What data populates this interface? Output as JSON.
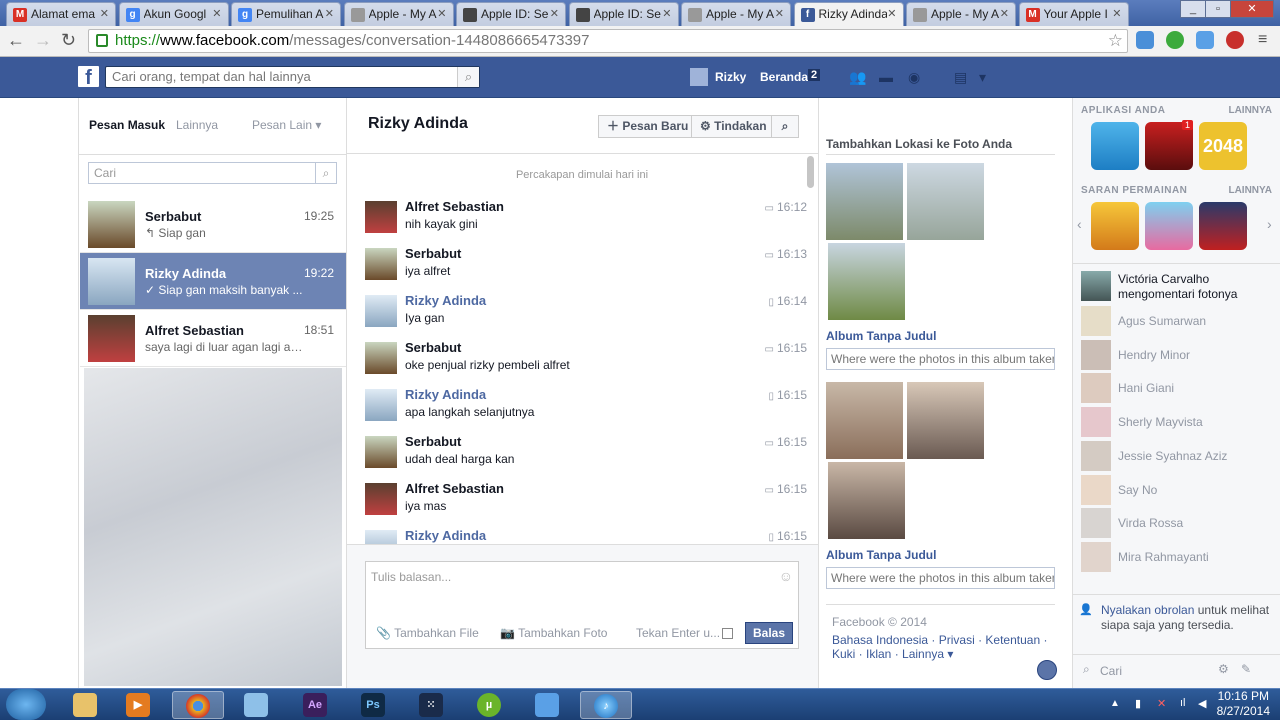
{
  "browser": {
    "tabs": [
      {
        "label": "Alamat ema",
        "fav": "M",
        "color": "#d93025"
      },
      {
        "label": "Akun Googl",
        "fav": "g",
        "color": "#4285f4"
      },
      {
        "label": "Pemulihan A",
        "fav": "g",
        "color": "#4285f4"
      },
      {
        "label": "Apple - My A",
        "fav": "",
        "color": "#999999"
      },
      {
        "label": "Apple ID: Se",
        "fav": "",
        "color": "#444444"
      },
      {
        "label": "Apple ID: Se",
        "fav": "",
        "color": "#444444"
      },
      {
        "label": "Apple - My A",
        "fav": "",
        "color": "#999999"
      },
      {
        "label": "Rizky Adinda",
        "fav": "f",
        "color": "#3b5998"
      },
      {
        "label": "Apple - My A",
        "fav": "",
        "color": "#999999"
      },
      {
        "label": "Your Apple I",
        "fav": "M",
        "color": "#d93025"
      }
    ],
    "url_scheme": "https://",
    "url_host": "www.facebook.com",
    "url_path": "/messages/conversation-1448086665473397"
  },
  "fb": {
    "search_placeholder": "Cari orang, tempat dan hal lainnya",
    "user_name": "Rizky",
    "home_label": "Beranda",
    "home_count": "2"
  },
  "inbox": {
    "tab_inbox": "Pesan Masuk",
    "tab_other": "Lainnya",
    "tab_more": "Pesan Lain",
    "search_placeholder": "Cari",
    "conversations": [
      {
        "name": "Serbabut",
        "time": "19:25",
        "preview": "↰ Siap gan"
      },
      {
        "name": "Rizky Adinda",
        "time": "19:22",
        "preview": "✓ Siap gan maksih banyak ..."
      },
      {
        "name": "Alfret Sebastian",
        "time": "18:51",
        "preview": "saya lagi di luar agan lagi ad..."
      }
    ]
  },
  "conversation": {
    "title": "Rizky Adinda",
    "new_message": "Pesan Baru",
    "actions": "Tindakan",
    "started": "Percakapan dimulai hari ini",
    "messages": [
      {
        "name": "Alfret Sebastian",
        "text": "nih kayak gini",
        "time": "16:12",
        "me": false
      },
      {
        "name": "Serbabut",
        "text": "iya alfret",
        "time": "16:13",
        "me": false
      },
      {
        "name": "Rizky Adinda",
        "text": "Iya gan",
        "time": "16:14",
        "me": true
      },
      {
        "name": "Serbabut",
        "text": "oke penjual rizky pembeli alfret",
        "time": "16:15",
        "me": false
      },
      {
        "name": "Rizky Adinda",
        "text": "apa langkah selanjutnya",
        "time": "16:15",
        "me": true
      },
      {
        "name": "Serbabut",
        "text": "udah deal harga kan",
        "time": "16:15",
        "me": false
      },
      {
        "name": "Alfret Sebastian",
        "text": "iya mas",
        "time": "16:15",
        "me": false
      },
      {
        "name": "Rizky Adinda",
        "text": "",
        "time": "16:15",
        "me": true
      }
    ],
    "reply_placeholder": "Tulis balasan...",
    "add_file": "Tambahkan File",
    "add_photo": "Tambahkan Foto",
    "press_enter": "Tekan Enter u...",
    "send": "Balas"
  },
  "photos": {
    "heading": "Tambahkan Lokasi ke Foto Anda",
    "album1": "Album Tanpa Judul",
    "album2": "Album Tanpa Judul",
    "location_placeholder": "Where were the photos in this album taken?",
    "copyright": "Facebook © 2014",
    "links1": "Bahasa Indonesia · Privasi · Ketentuan ·",
    "links2": "Kuki · Iklan · Lainnya ▾"
  },
  "sidebar": {
    "apps_title": "APLIKASI ANDA",
    "more": "LAINNYA",
    "games_title": "SARAN PERMAINAN",
    "more2": "LAINNYA",
    "app_2048": "2048",
    "poker_badge": "1",
    "activity_name": "Victória Carvalho",
    "activity_text": "mengomentari fotonya",
    "friends": [
      "Agus Sumarwan",
      "Hendry Minor",
      "Hani Giani",
      "Sherly Mayvista",
      "Jessie Syahnaz Aziz",
      "Say No",
      "Virda Rossa",
      "Mira Rahmayanti"
    ],
    "chat_on_link": "Nyalakan obrolan",
    "chat_on_text": " untuk melihat siapa saja yang tersedia.",
    "chat_search": "Cari"
  },
  "taskbar": {
    "time": "10:16 PM",
    "date": "8/27/2014"
  }
}
